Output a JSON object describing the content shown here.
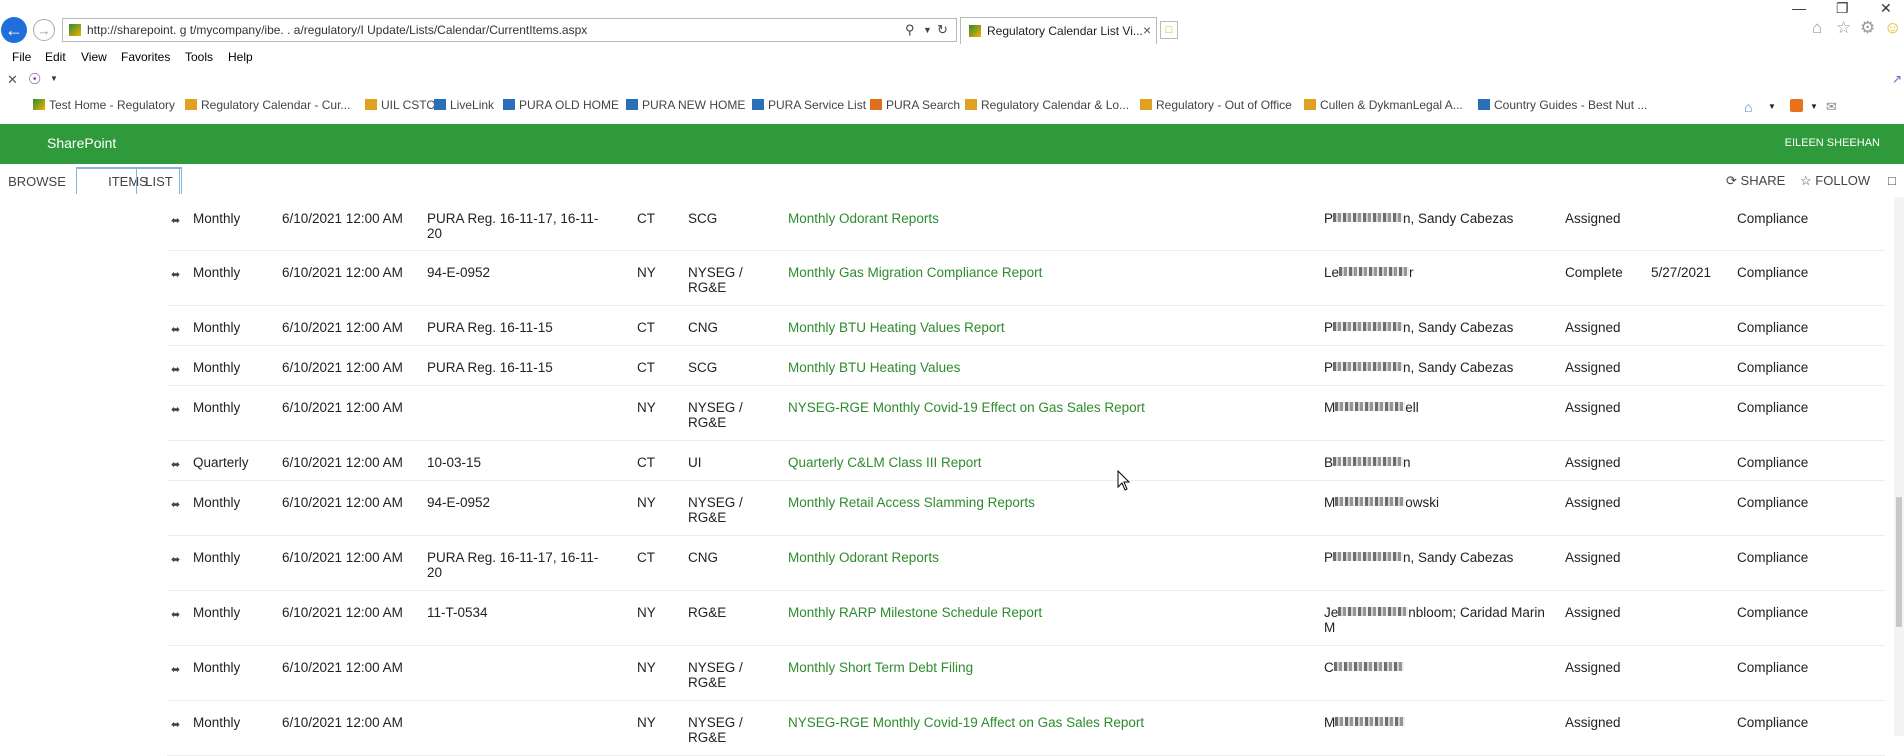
{
  "browser": {
    "url": "http://sharepoint.  g   t/mycompany/ibe.  .  a/regulatory/I             Update/Lists/Calendar/CurrentItems.aspx",
    "tab_title": "Regulatory Calendar List Vi...",
    "tab_close": "×",
    "menu": [
      "File",
      "Edit",
      "View",
      "Favorites",
      "Tools",
      "Help"
    ],
    "favorites": [
      "Test Home - Regulatory",
      "Regulatory Calendar - Cur...",
      "UIL CSTO",
      "LiveLink",
      "PURA OLD HOME",
      "PURA NEW HOME",
      "PURA Service List",
      "PURA Search",
      "Regulatory Calendar & Lo...",
      "Regulatory - Out of Office",
      "Cullen & DykmanLegal A...",
      "Country Guides - Best Nut ..."
    ]
  },
  "suite": {
    "brand": "SharePoint",
    "user": "EILEEN SHEEHAN"
  },
  "ribbon": {
    "tabs": [
      "BROWSE",
      "ITEMS",
      "LIST"
    ],
    "share": "SHARE",
    "follow": "FOLLOW"
  },
  "rows": [
    {
      "freq": "Monthly",
      "date": "6/10/2021 12:00 AM",
      "ref": "PURA Reg. 16-11-17, 16-11-\n20",
      "state": "CT",
      "co": "SCG",
      "title": "Monthly Odorant Reports",
      "assigned_prefix": "P",
      "assigned_suffix": "n, Sandy Cabezas",
      "status": "Assigned",
      "completed": "",
      "dept": "Compliance"
    },
    {
      "freq": "Monthly",
      "date": "6/10/2021 12:00 AM",
      "ref": "94-E-0952",
      "state": "NY",
      "co": "NYSEG /\nRG&E",
      "title": "Monthly Gas Migration Compliance Report",
      "assigned_prefix": "Le",
      "assigned_suffix": "r",
      "status": "Complete",
      "completed": "5/27/2021",
      "dept": "Compliance"
    },
    {
      "freq": "Monthly",
      "date": "6/10/2021 12:00 AM",
      "ref": "PURA Reg. 16-11-15",
      "state": "CT",
      "co": "CNG",
      "title": "Monthly BTU Heating Values Report",
      "assigned_prefix": "P",
      "assigned_suffix": "n, Sandy Cabezas",
      "status": "Assigned",
      "completed": "",
      "dept": "Compliance"
    },
    {
      "freq": "Monthly",
      "date": "6/10/2021 12:00 AM",
      "ref": "PURA Reg. 16-11-15",
      "state": "CT",
      "co": "SCG",
      "title": "Monthly BTU Heating Values",
      "assigned_prefix": "P",
      "assigned_suffix": "n, Sandy Cabezas",
      "status": "Assigned",
      "completed": "",
      "dept": "Compliance"
    },
    {
      "freq": "Monthly",
      "date": "6/10/2021 12:00 AM",
      "ref": "",
      "state": "NY",
      "co": "NYSEG /\nRG&E",
      "title": "NYSEG-RGE Monthly Covid-19 Effect on Gas Sales Report",
      "assigned_prefix": "M",
      "assigned_suffix": "ell",
      "status": "Assigned",
      "completed": "",
      "dept": "Compliance"
    },
    {
      "freq": "Quarterly",
      "date": "6/10/2021 12:00 AM",
      "ref": "10-03-15",
      "state": "CT",
      "co": "UI",
      "title": "Quarterly C&LM Class III Report",
      "assigned_prefix": "B",
      "assigned_suffix": "n",
      "status": "Assigned",
      "completed": "",
      "dept": "Compliance"
    },
    {
      "freq": "Monthly",
      "date": "6/10/2021 12:00 AM",
      "ref": "94-E-0952",
      "state": "NY",
      "co": "NYSEG /\nRG&E",
      "title": "Monthly Retail Access Slamming Reports",
      "assigned_prefix": "M",
      "assigned_suffix": "owski",
      "status": "Assigned",
      "completed": "",
      "dept": "Compliance"
    },
    {
      "freq": "Monthly",
      "date": "6/10/2021 12:00 AM",
      "ref": "PURA Reg. 16-11-17, 16-11-\n20",
      "state": "CT",
      "co": "CNG",
      "title": "Monthly Odorant Reports",
      "assigned_prefix": "P",
      "assigned_suffix": "n, Sandy Cabezas",
      "status": "Assigned",
      "completed": "",
      "dept": "Compliance"
    },
    {
      "freq": "Monthly",
      "date": "6/10/2021 12:00 AM",
      "ref": "11-T-0534",
      "state": "NY",
      "co": "RG&E",
      "title": "Monthly RARP Milestone Schedule Report",
      "assigned_prefix": "Je",
      "assigned_suffix": "nbloom; Caridad Marin\nM",
      "status": "Assigned",
      "completed": "",
      "dept": "Compliance"
    },
    {
      "freq": "Monthly",
      "date": "6/10/2021 12:00 AM",
      "ref": "",
      "state": "NY",
      "co": "NYSEG /\nRG&E",
      "title": "Monthly Short Term Debt Filing",
      "assigned_prefix": "C",
      "assigned_suffix": "",
      "status": "Assigned",
      "completed": "",
      "dept": "Compliance"
    },
    {
      "freq": "Monthly",
      "date": "6/10/2021 12:00 AM",
      "ref": "",
      "state": "NY",
      "co": "NYSEG /\nRG&E",
      "title": "NYSEG-RGE Monthly Covid-19 Affect on Gas Sales Report",
      "assigned_prefix": "M",
      "assigned_suffix": "",
      "status": "Assigned",
      "completed": "",
      "dept": "Compliance"
    }
  ]
}
